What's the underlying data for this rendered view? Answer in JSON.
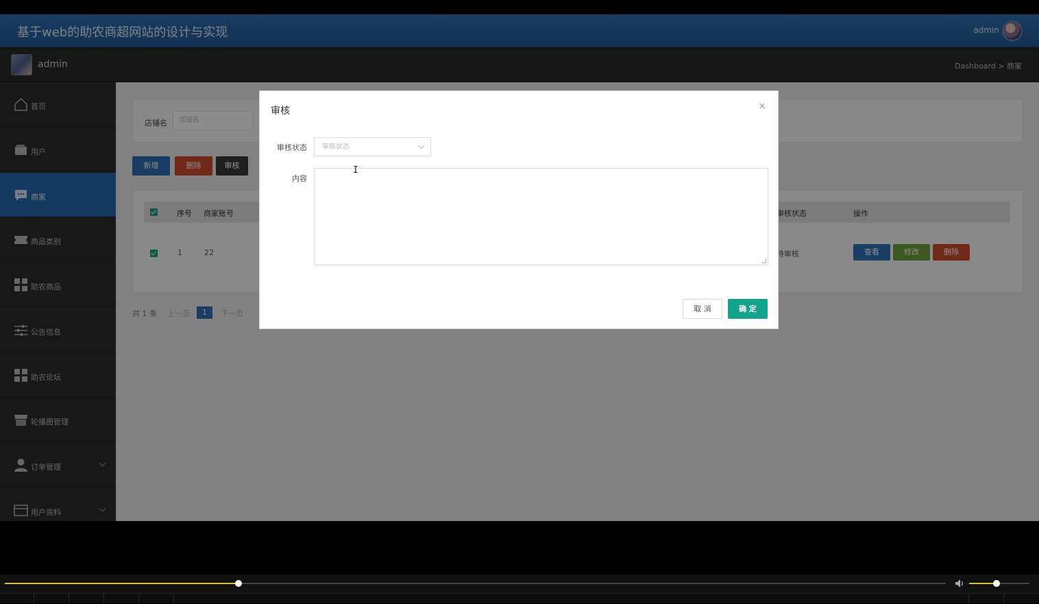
{
  "app": {
    "title": "基于web的助农商超网站的设计与实现",
    "top_user": "admin",
    "sub_user": "admin",
    "breadcrumb": "Dashboard > 商家"
  },
  "sidebar": {
    "items": [
      {
        "label": "首页",
        "icon": "home-icon"
      },
      {
        "label": "用户",
        "icon": "wallet-icon"
      },
      {
        "label": "商家",
        "icon": "chat-icon",
        "active": true
      },
      {
        "label": "商品类别",
        "icon": "ticket-icon"
      },
      {
        "label": "助农商品",
        "icon": "grid-icon"
      },
      {
        "label": "公告信息",
        "icon": "sliders-icon"
      },
      {
        "label": "助农论坛",
        "icon": "grid-icon"
      },
      {
        "label": "轮播图管理",
        "icon": "store-icon"
      },
      {
        "label": "订单管理",
        "icon": "user-icon",
        "expandable": true
      },
      {
        "label": "用户资料",
        "icon": "card-icon",
        "expandable": true
      }
    ]
  },
  "search": {
    "label": "店铺名",
    "placeholder": "店铺名"
  },
  "toolbar": {
    "add_label": "新增",
    "delete_label": "删除",
    "audit_label": "审核"
  },
  "table": {
    "headers": {
      "index": "序号",
      "account": "商家账号",
      "audit_status": "审核状态",
      "actions": "操作"
    },
    "rows": [
      {
        "index": "1",
        "account": "22",
        "audit_status": "待审核",
        "view": "查看",
        "edit": "修改",
        "delete": "删除"
      }
    ]
  },
  "pager": {
    "total": "共 1 条",
    "prev": "上一页",
    "current": "1",
    "next": "下一页"
  },
  "dialog": {
    "title": "审核",
    "close": "×",
    "status_label": "审核状态",
    "status_placeholder": "审核状态",
    "content_label": "内容",
    "cancel_label": "取 消",
    "ok_label": "确 定"
  },
  "player": {
    "progress": 0.248,
    "volume": 0.45
  },
  "colors": {
    "primary": "#2d6db2",
    "danger": "#d04a2c",
    "success": "#12a38d",
    "edit": "#6aa13a",
    "progress": "#e8c31a"
  }
}
